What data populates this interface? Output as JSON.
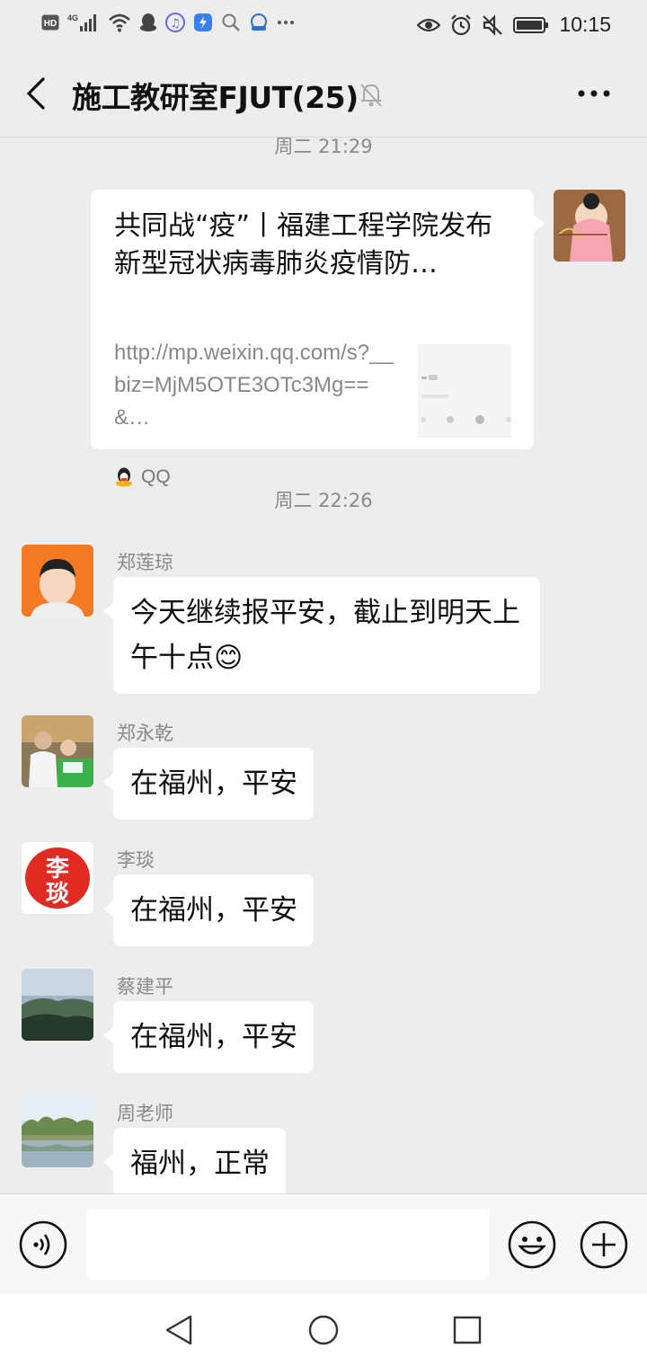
{
  "status_bar": {
    "hd_label": "HD",
    "network_label": "4G",
    "time": "10:15",
    "icons_left": [
      "hd-icon",
      "signal-icon",
      "wifi-icon",
      "qq-icon",
      "music-icon",
      "app-icon",
      "search-icon",
      "cloud-icon",
      "more-dots-icon"
    ],
    "icons_right": [
      "eye-icon",
      "alarm-icon",
      "mute-icon",
      "battery-icon"
    ]
  },
  "header": {
    "title": "施工教研室FJUT(25)",
    "icons": [
      "back-icon",
      "mute-bell-icon",
      "more-icon"
    ]
  },
  "chat": {
    "timestamp_1": "周二 21:29",
    "link_card": {
      "title": "共同战“疫”丨福建工程学院发布新型冠状病毒肺炎疫情防…",
      "url": "http://mp.weixin.qq.com/s?__biz=MjM5OTE3OTc3Mg==&…",
      "source": "QQ"
    },
    "timestamp_2": "周二 22:26",
    "messages": [
      {
        "sender": "郑莲琼",
        "text": "今天继续报平安，截止到明天上午十点",
        "emoji": "😊"
      },
      {
        "sender": "郑永乾",
        "text": "在福州，平安"
      },
      {
        "sender": "李琰",
        "text": "在福州，平安",
        "avatar_text": "李琰"
      },
      {
        "sender": "蔡建平",
        "text": "在福州，平安"
      },
      {
        "sender": "周老师",
        "text": "福州，正常"
      }
    ]
  },
  "input_bar": {
    "icons": [
      "voice-icon",
      "emoji-icon",
      "plus-icon"
    ]
  },
  "nav_bar": {
    "icons": [
      "nav-back-icon",
      "nav-home-icon",
      "nav-recents-icon"
    ]
  },
  "colors": {
    "background": "#ededed",
    "bubble": "#ffffff",
    "muted_text": "#8a8a8a"
  }
}
